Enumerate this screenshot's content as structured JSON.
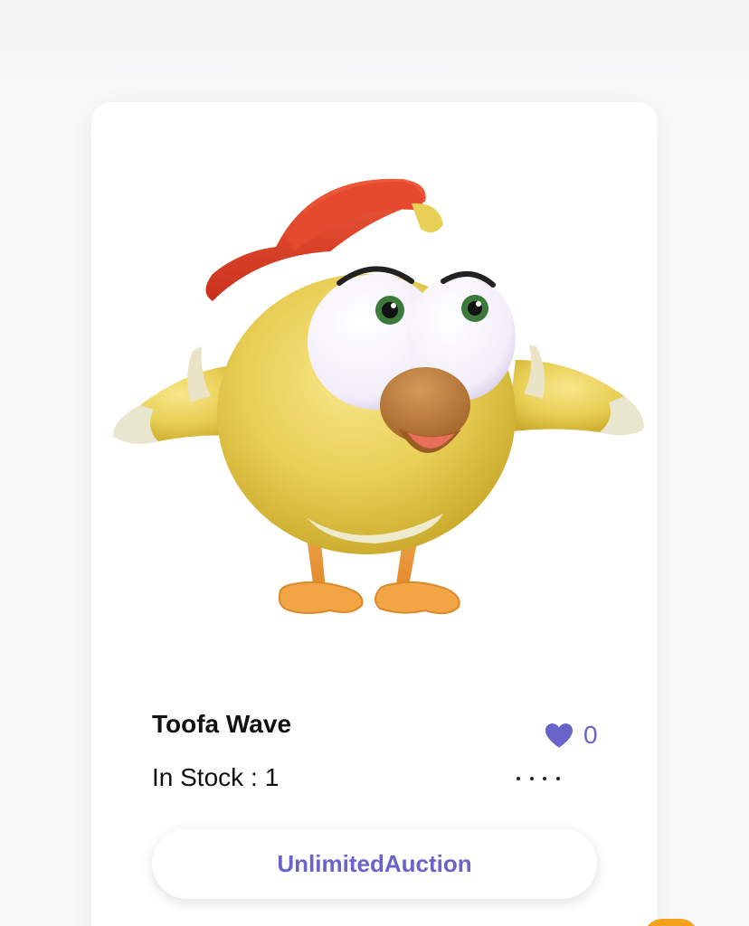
{
  "product": {
    "name": "Toofa Wave",
    "stock_label": "In Stock :",
    "stock_value": "1",
    "likes": "0",
    "cta_label": "UnlimitedAuction"
  },
  "icons": {
    "like": "heart-icon",
    "more": "more-dots-icon"
  },
  "colors": {
    "accent": "#6a63c9",
    "text": "#111111",
    "card": "#ffffff",
    "background": "#f7f7f8"
  }
}
